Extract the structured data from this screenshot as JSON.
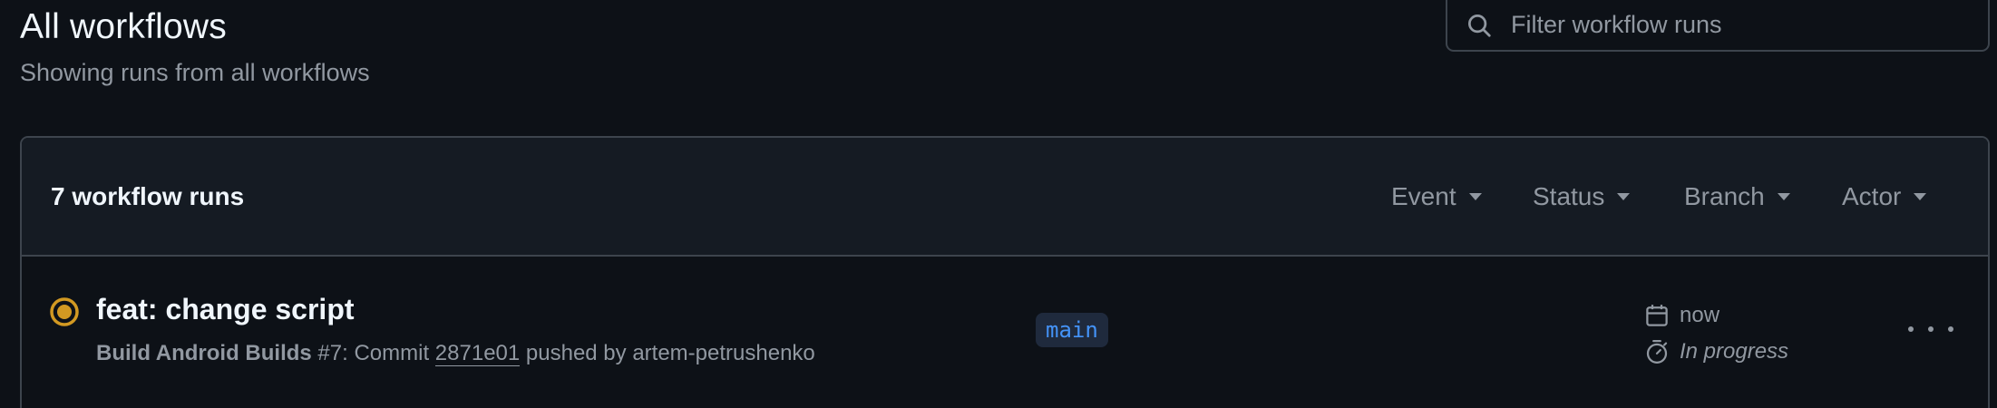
{
  "page": {
    "title": "All workflows",
    "subtitle": "Showing runs from all workflows"
  },
  "search": {
    "placeholder": "Filter workflow runs",
    "value": ""
  },
  "runs": {
    "count_label": "7 workflow runs",
    "filters": [
      "Event",
      "Status",
      "Branch",
      "Actor"
    ],
    "items": [
      {
        "status": "in-progress",
        "status_icon": "in-progress-icon",
        "title": "feat: change script",
        "workflow": "Build Android Builds",
        "run_number": "#7",
        "meta_mid": ": Commit ",
        "commit": "2871e01",
        "meta_end": " pushed by artem-petrushenko",
        "branch": "main",
        "time": "now",
        "duration": "In progress"
      }
    ]
  },
  "colors": {
    "background": "#0d1117",
    "header_background": "#151b23",
    "border": "#3d444d",
    "in_progress": "#d29922",
    "branch_text": "#4493f8",
    "branch_bg": "#1f2a3d",
    "muted_text": "#9198a1"
  }
}
